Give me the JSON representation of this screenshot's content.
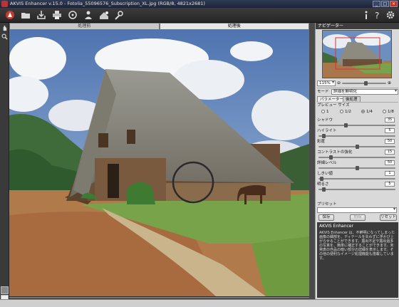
{
  "window": {
    "title": "AKVIS Enhancer v.15.0 - Fotolia_55096576_Subscription_XL.jpg (RGB/8, 4821x2681)"
  },
  "tabs": [
    {
      "label": "処理前",
      "active": false
    },
    {
      "label": "処理後",
      "active": true
    }
  ],
  "toolbar_icons": [
    "open-icon",
    "save-icon",
    "print-icon",
    "batch-icon",
    "share-icon",
    "plugin-icon",
    "preferences-icon",
    "settings-icon",
    "about-icon",
    "help-icon"
  ],
  "navigator": {
    "title": "ナビゲーター",
    "zoom": "115%",
    "zoom_level": 0.55
  },
  "mode": {
    "label": "モード",
    "value": "詳細を鮮明化"
  },
  "param_tabs": [
    {
      "label": "パラメーター",
      "active": true
    },
    {
      "label": "後処理",
      "active": false
    }
  ],
  "preview": {
    "label": "プレビュー サイズ",
    "options": [
      {
        "label": "1",
        "selected": false
      },
      {
        "label": "1/2",
        "selected": false
      },
      {
        "label": "1/4",
        "selected": true
      },
      {
        "label": "1/8",
        "selected": false
      }
    ]
  },
  "params": [
    {
      "label": "シャドウ",
      "value": "35",
      "level": 0.35
    },
    {
      "label": "ハイライト",
      "value": "5",
      "level": 0.05
    },
    {
      "label": "彩度",
      "value": "50",
      "level": 0.5
    },
    {
      "label": "コントラストの強化",
      "value": "15",
      "level": 0.15
    },
    {
      "label": "詳細レベル",
      "value": "50",
      "level": 0.5
    },
    {
      "label": "しきい値",
      "value": "1",
      "level": 0.02
    },
    {
      "label": "明るさ",
      "value": "5",
      "level": 0.05
    }
  ],
  "presets": {
    "label": "プリセット",
    "value": "",
    "save_label": "保存",
    "delete_label": "削除",
    "reset_label": "リセット"
  },
  "help": {
    "title": "AKVIS Enhancer",
    "text": "AKVIS Enhancer は、不鮮明になってしまった画像の細部を、ディテールを失わずに浮かび上がらせることができます。露出不足や露出過多の写真を、簡単に補正することができます。未発表の作品の暗い部分の詳細を表示します。その他の便利なイメージ処理機能も搭載しています。"
  }
}
